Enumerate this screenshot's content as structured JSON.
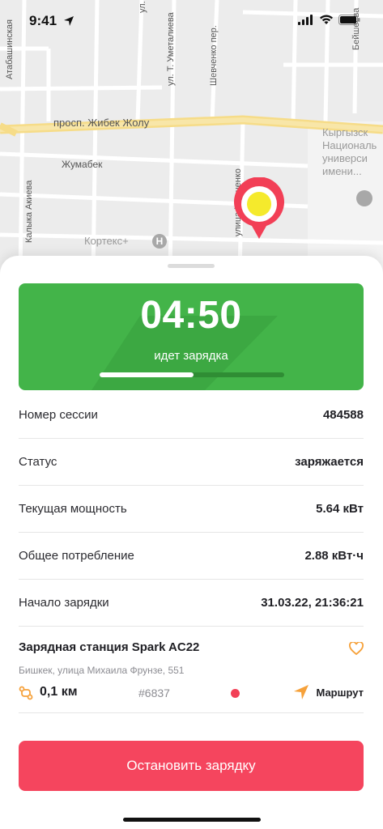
{
  "status_bar": {
    "time": "9:41"
  },
  "map": {
    "labels": {
      "avenue": "просп. Жибек Жолу",
      "street_zhumabek": "Жумабек",
      "street_kalyka": "Калыка Акиева",
      "street_atabashinskaya": "Атабашинская",
      "street_umetalieva": "ул. Т. Уметалиева",
      "street_shevchenko_lane": "Шевченко пер.",
      "street_shevchenko": "улица Шевченко",
      "street_ul": "ул.",
      "street_top_right": "Бейшеева",
      "poi_kortex": "Кортекс+",
      "poi_hospital_letter": "Н",
      "poi_university": "Кыргызск\nНациональ\nуниверси\nимени..."
    }
  },
  "session": {
    "timer": "04:50",
    "status_text": "идет зарядка",
    "progress": 0.51
  },
  "info": [
    {
      "label": "Номер сессии",
      "value": "484588"
    },
    {
      "label": "Статус",
      "value": "заряжается"
    },
    {
      "label": "Текущая мощность",
      "value": "5.64 кВт"
    },
    {
      "label": "Общее потребление",
      "value": "2.88 кВт·ч"
    },
    {
      "label": "Начало зарядки",
      "value": "31.03.22, 21:36:21"
    }
  ],
  "station": {
    "name": "Зарядная станция Spark AC22",
    "address": "Бишкек, улица Михаила Фрунзе, 551",
    "distance": "0,1 км",
    "id": "#6837",
    "route_label": "Маршрут"
  },
  "actions": {
    "stop_label": "Остановить зарядку"
  },
  "colors": {
    "accent_green": "#43b449",
    "danger_red": "#f5455e",
    "pin_red": "#f23f56",
    "pin_yellow": "#f5ea2c",
    "route_orange": "#f6a13a"
  }
}
